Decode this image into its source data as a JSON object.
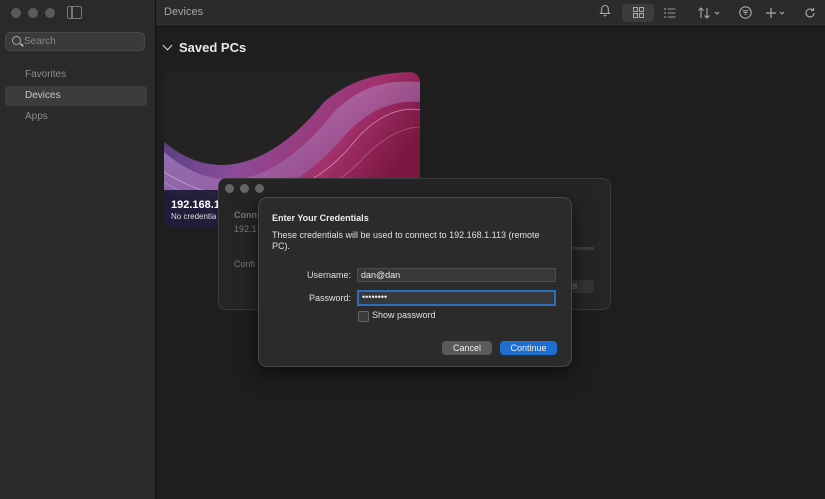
{
  "window": {
    "title": "Devices"
  },
  "sidebar": {
    "search_placeholder": "Search",
    "items": [
      {
        "label": "Favorites",
        "active": false
      },
      {
        "label": "Devices",
        "active": true
      },
      {
        "label": "Apps",
        "active": false
      }
    ]
  },
  "toolbar": {
    "icons": [
      "bell-icon",
      "grid-view-icon",
      "list-view-icon",
      "sort-icon",
      "filter-icon",
      "add-icon",
      "refresh-icon"
    ]
  },
  "section": {
    "title": "Saved PCs"
  },
  "card": {
    "label": "192.168.1",
    "sublabel": "No credentia"
  },
  "back_dialog": {
    "line1": "Conn",
    "line2": "192.1",
    "line3": "Confi",
    "cut_button": "el"
  },
  "dialog": {
    "title": "Enter Your Credentials",
    "description": "These credentials will be used to connect to 192.168.1.113 (remote PC).",
    "username_label": "Username:",
    "username_value": "dan@dan",
    "password_label": "Password:",
    "password_value": "••••••••",
    "show_password_label": "Show password",
    "show_password_checked": false,
    "cancel_label": "Cancel",
    "continue_label": "Continue"
  },
  "colors": {
    "accent": "#1f6fd1",
    "focus_ring": "#2a6fb7"
  }
}
